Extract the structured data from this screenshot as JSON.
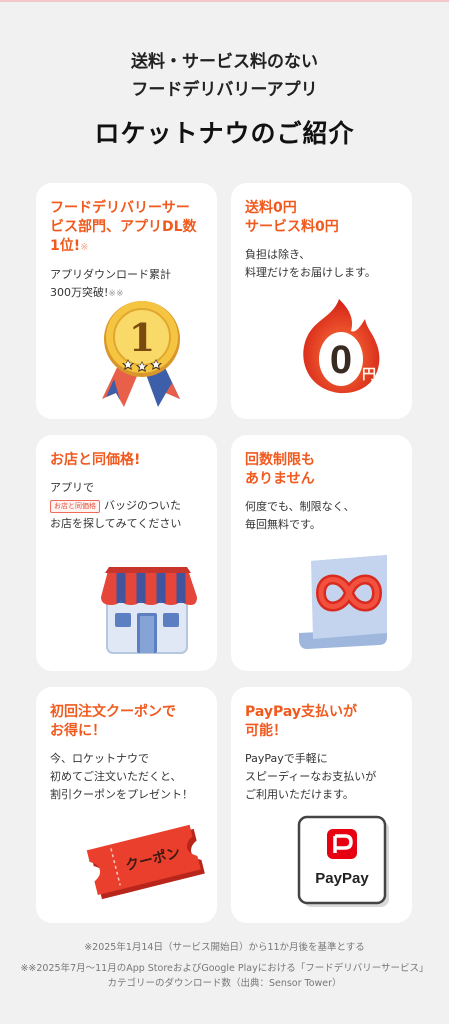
{
  "header": {
    "subtitle_line1": "送料・サービス料のない",
    "subtitle_line2": "フードデリバリーアプリ",
    "title": "ロケットナウのご紹介"
  },
  "cards": [
    {
      "title": "フードデリバリーサー\nビス部門、アプリDL数\n1位!",
      "title_mark": "※",
      "desc": "アプリダウンロード累計\n300万突破!",
      "desc_mark": "※※",
      "icon": "medal-icon"
    },
    {
      "title": "送料0円\nサービス料0円",
      "desc": "負担は除き、\n料理だけをお届けします。",
      "icon": "fire-zero-yen-icon",
      "icon_text": "0",
      "icon_unit": "円"
    },
    {
      "title": "お店と同価格!",
      "desc_prefix": "アプリで",
      "badge": "お店と同価格",
      "desc": "バッジのついた\nお店を探してみてください",
      "icon": "store-icon"
    },
    {
      "title": "回数制限も\n ありません",
      "desc": "何度でも、制限なく、\n毎回無料です。",
      "icon": "infinity-icon"
    },
    {
      "title": "初回注文クーポンで\nお得に！",
      "desc": "今、ロケットナウで\n初めてご注文いただくと、\n割引クーポンをプレゼント！",
      "icon": "coupon-ticket-icon",
      "icon_text": "クーポン"
    },
    {
      "title": "PayPay支払いが\n可能！",
      "desc": "PayPayで手軽に\nスピーディーなお支払いが\nご利用いただけます。",
      "icon": "paypay-logo-icon",
      "icon_text": "PayPay"
    }
  ],
  "footnotes": {
    "note1": "※2025年1月14日（サービス開始日）から11か月後を基準とする",
    "note2": "※※2025年7月～11月のApp StoreおよびGoogle Playにおける「フードデリバリーサービス」カテゴリーのダウンロード数（出典：Sensor Tower）"
  },
  "colors": {
    "background": "#f1f1f1",
    "card": "#ffffff",
    "accent": "#f05a1e",
    "paypay_red": "#e60012"
  }
}
